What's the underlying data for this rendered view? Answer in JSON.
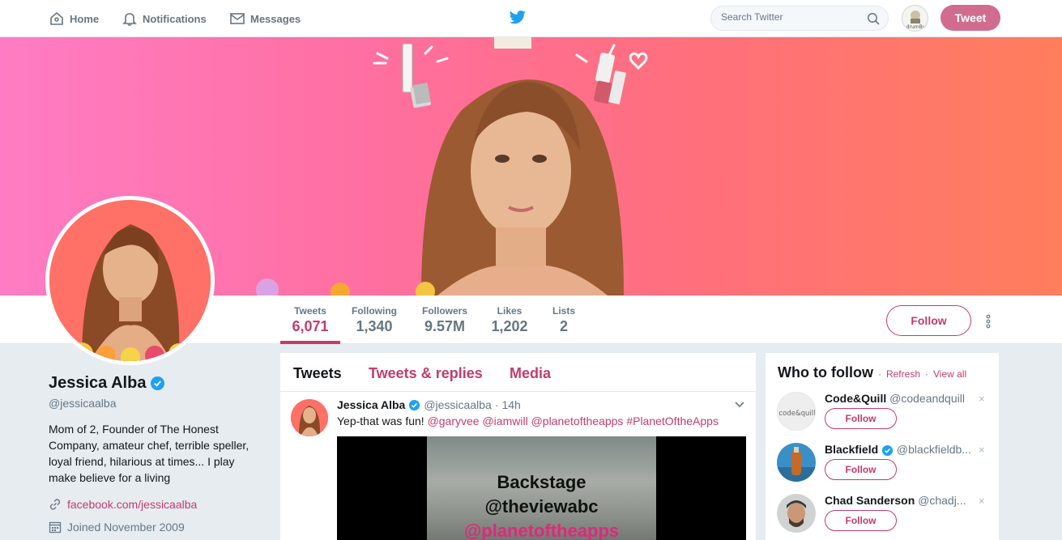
{
  "nav": {
    "home": "Home",
    "notifications": "Notifications",
    "messages": "Messages",
    "search_placeholder": "Search Twitter",
    "tweet_button": "Tweet",
    "avatar_text": "drumBy"
  },
  "colors": {
    "accent": "#c23c6e",
    "tweet_button": "#d06d8f",
    "verified": "#1da1f2",
    "twitter_blue": "#1da1f2"
  },
  "stats": [
    {
      "label": "Tweets",
      "value": "6,071",
      "active": true
    },
    {
      "label": "Following",
      "value": "1,340"
    },
    {
      "label": "Followers",
      "value": "9.57M"
    },
    {
      "label": "Likes",
      "value": "1,202"
    },
    {
      "label": "Lists",
      "value": "2"
    }
  ],
  "profile": {
    "follow_label": "Follow",
    "name": "Jessica Alba",
    "handle": "@jessicaalba",
    "bio": "Mom of 2, Founder of The Honest Company, amateur chef, terrible speller, loyal friend, hilarious at times... I play make believe for a living",
    "website": "facebook.com/jessicaalba",
    "joined": "Joined November 2009"
  },
  "timeline": {
    "tabs": [
      "Tweets",
      "Tweets & replies",
      "Media"
    ],
    "tweet": {
      "name": "Jessica Alba",
      "handle": "@jessicaalba",
      "separator": "·",
      "time": "14h",
      "text_plain": "Yep-that was fun! ",
      "mentions": "@garyvee @iamwill @planetoftheapps #PlanetOftheApps",
      "media_lines": [
        "Backstage",
        "@theviewabc",
        "@planetoftheapps"
      ]
    }
  },
  "who_to_follow": {
    "title": "Who to follow",
    "separator": "·",
    "refresh": "Refresh",
    "view_all": "View all",
    "follow_label": "Follow",
    "dismiss": "×",
    "items": [
      {
        "name": "Code&Quill",
        "handle": "@codeandquill",
        "verified": false,
        "avatar_text": "code&quill"
      },
      {
        "name": "Blackfield",
        "handle": "@blackfieldb...",
        "verified": true
      },
      {
        "name": "Chad Sanderson",
        "handle": "@chadj...",
        "verified": false
      }
    ]
  }
}
